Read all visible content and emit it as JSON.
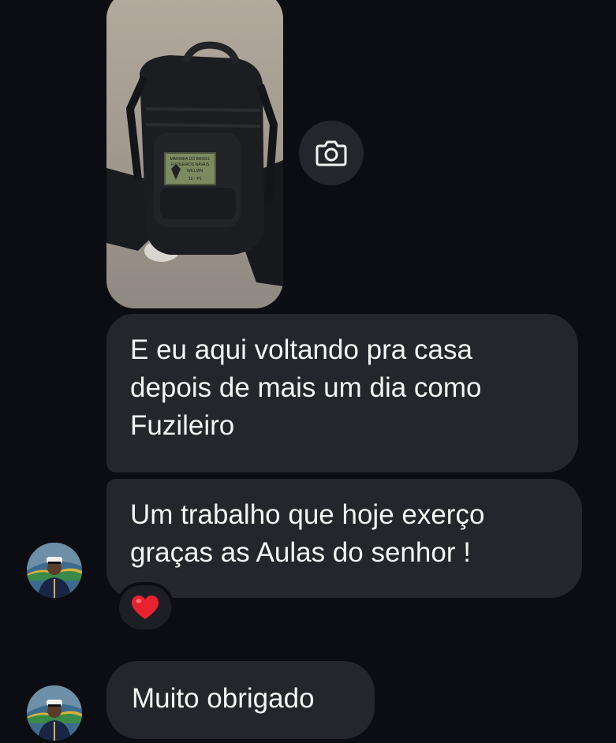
{
  "photo_message": {
    "image_desc": "Black tactical backpack with green name patch",
    "patch_lines": [
      "MARINHA DO BRASIL",
      "FUZILEIROS NAVAIS",
      "WILLIAN",
      "'10 - 'P1"
    ]
  },
  "camera_button": {
    "icon": "camera-icon"
  },
  "messages": [
    {
      "lines": [
        "E eu aqui voltando pra casa",
        "depois de mais um dia como",
        "Fuzileiro"
      ]
    },
    {
      "lines": [
        "Um trabalho que hoje exerço",
        "graças as Aulas do senhor !"
      ],
      "reaction": "❤️"
    },
    {
      "lines": [
        "Muito obrigado"
      ]
    }
  ],
  "colors": {
    "background": "#0c0d12",
    "bubble": "#24262b",
    "text": "#f4f4f4",
    "reaction_heart": "#e8232f"
  }
}
